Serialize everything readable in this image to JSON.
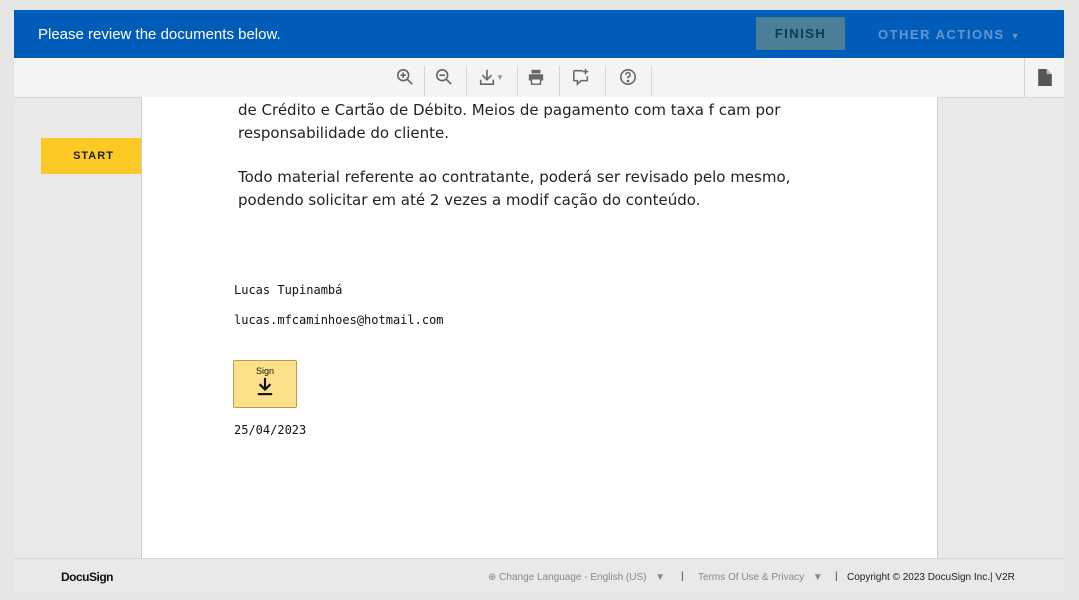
{
  "header": {
    "message": "Please review the documents below.",
    "finish_label": "FINISH",
    "other_actions_label": "OTHER ACTIONS"
  },
  "toolbar": {
    "icons": [
      "zoom-in-icon",
      "zoom-out-icon",
      "download-icon",
      "print-icon",
      "add-comment-icon",
      "help-icon",
      "document-icon"
    ]
  },
  "start_label": "START",
  "document": {
    "para1_line1": "de Crédito e Cartão de Débito. Meios de pagamento com taxa f cam por",
    "para1_line2": "responsabilidade do cliente.",
    "para2_line1": "Todo material referente ao contratante, poderá ser revisado pelo mesmo,",
    "para2_line2": "podendo solicitar em até 2 vezes a modif cação do conteúdo.",
    "signer_name": "Lucas Tupinambá",
    "signer_email": "lucas.mfcaminhoes@hotmail.com",
    "sign_label": "Sign",
    "date": "25/04/2023"
  },
  "footer": {
    "brand": "DocuSign",
    "language": "Change Language - English (US)",
    "terms": "Terms Of Use & Privacy",
    "copyright": "Copyright © 2023 DocuSign Inc.",
    "version": "V2R"
  },
  "colors": {
    "header_bg": "#005cb9",
    "finish_bg": "#4b7f97",
    "start_bg": "#fcc925",
    "sign_bg": "#fde08a"
  }
}
